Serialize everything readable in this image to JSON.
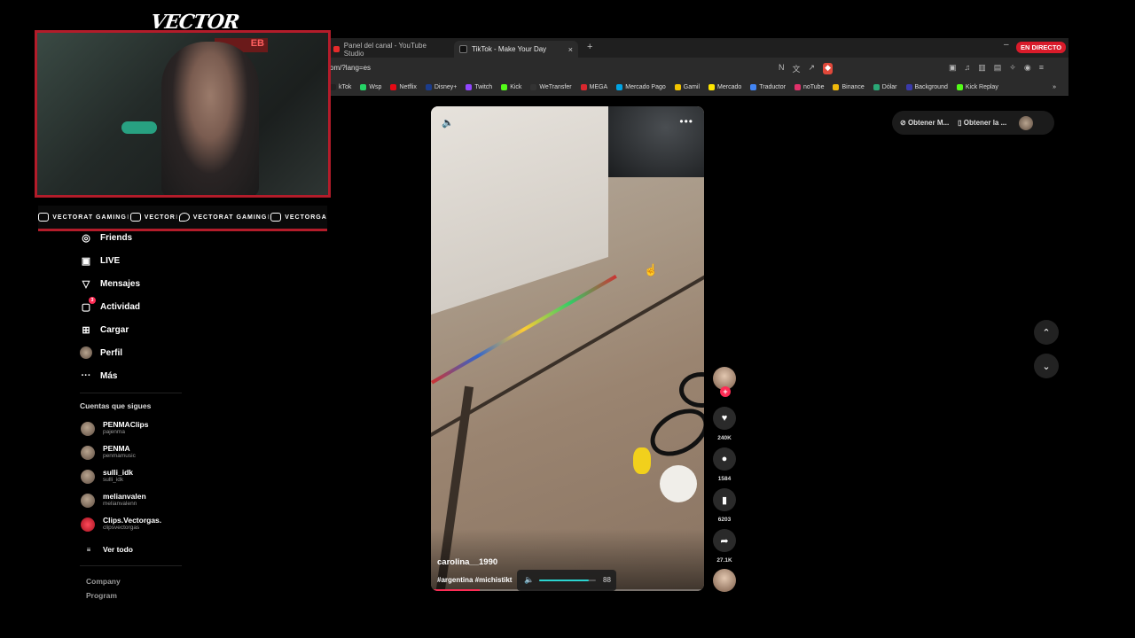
{
  "browser": {
    "tabs": [
      {
        "label": "Panel del canal - YouTube Studio",
        "color": "#e52b2b"
      },
      {
        "label": "TikTok - Make Your Day",
        "color": "#111111"
      }
    ],
    "tab_close": "×",
    "new_tab": "+",
    "minimize": "–",
    "live_badge": "EN DIRECTO",
    "url": "om/?lang=es",
    "bookmarks": [
      {
        "label": "kTok",
        "color": "#222222"
      },
      {
        "label": "Wsp",
        "color": "#25d366"
      },
      {
        "label": "Netflix",
        "color": "#e50914"
      },
      {
        "label": "Disney+",
        "color": "#1b3c8c"
      },
      {
        "label": "Twitch",
        "color": "#9146ff"
      },
      {
        "label": "Kick",
        "color": "#53fc18"
      },
      {
        "label": "WeTransfer",
        "color": "#333333"
      },
      {
        "label": "MEGA",
        "color": "#d9272e"
      },
      {
        "label": "Mercado Pago",
        "color": "#00a4e4"
      },
      {
        "label": "Gamil",
        "color": "#f2c400"
      },
      {
        "label": "Mercado",
        "color": "#ffe600"
      },
      {
        "label": "Traductor",
        "color": "#4285f4"
      },
      {
        "label": "noTube",
        "color": "#e0316a"
      },
      {
        "label": "Binance",
        "color": "#f0b90b"
      },
      {
        "label": "Dólar",
        "color": "#2aa876"
      },
      {
        "label": "Background",
        "color": "#3a3aaa"
      },
      {
        "label": "Kick Replay",
        "color": "#53fc18"
      }
    ],
    "bookmarks_more": "»"
  },
  "overlay": {
    "logo": "VECTOR",
    "cam_sign": "EB",
    "socials": [
      {
        "label": "VECTORAT GAMING"
      },
      {
        "label": "VECTOR"
      },
      {
        "label": "VECTORAT GAMING"
      },
      {
        "label": "VECTORGA"
      }
    ],
    "separator": "I"
  },
  "sidebar": {
    "items": [
      {
        "label": "Friends",
        "icon": "👥"
      },
      {
        "label": "LIVE",
        "icon": "▣"
      },
      {
        "label": "Mensajes",
        "icon": "▽"
      },
      {
        "label": "Actividad",
        "icon": "▢",
        "badge": "3"
      },
      {
        "label": "Cargar",
        "icon": "⊞"
      },
      {
        "label": "Perfil",
        "icon": ""
      },
      {
        "label": "Más",
        "icon": "···"
      }
    ],
    "following_title": "Cuentas que sigues",
    "accounts": [
      {
        "name": "PENMAClips",
        "user": "pajenma"
      },
      {
        "name": "PENMA",
        "user": "penmamusic"
      },
      {
        "name": "sulli_idk",
        "user": "sulli_idk"
      },
      {
        "name": "melianvalen",
        "user": "melianvalenn"
      },
      {
        "name": "Clips.Vectorgas.",
        "user": "clipsvectorgas"
      }
    ],
    "see_all": "Ver todo",
    "see_all_icon": "≡",
    "footer": [
      "Company",
      "Program"
    ]
  },
  "video": {
    "username": "carolina__1990",
    "tags": "#argentina #michistikt",
    "volume_value": "88",
    "volume_level": 0.88,
    "progress": 0.18,
    "more": "•••",
    "sound_icon": "🔈"
  },
  "actions": {
    "like_count": "240K",
    "comment_count": "1584",
    "save_count": "6203",
    "share_count": "27.1K",
    "follow_plus": "+"
  },
  "top_right": {
    "get_app_1": "Obtener M...",
    "get_app_2": "Obtener la ..."
  },
  "nav": {
    "up": "⌃",
    "down": "⌄"
  }
}
